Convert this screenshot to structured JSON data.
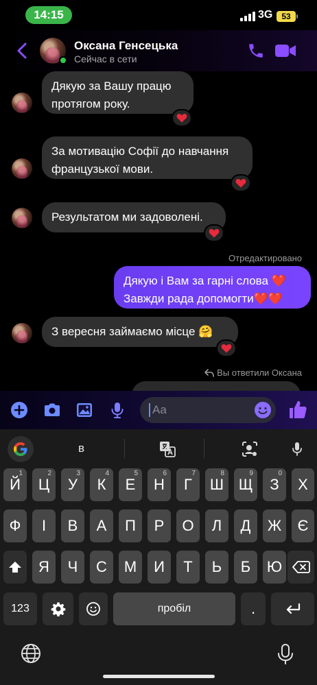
{
  "status_bar": {
    "time": "14:15",
    "network": "3G",
    "battery": "53"
  },
  "header": {
    "contact_name": "Оксана Генсецька",
    "contact_status": "Сейчас в сети"
  },
  "messages": [
    {
      "direction": "in",
      "lines": [
        "Дякую за Вашу працю",
        "протягом року."
      ],
      "reaction": "heart"
    },
    {
      "direction": "in",
      "lines": [
        "За мотивацію Софії до навчання",
        "французької мови."
      ],
      "reaction": "heart"
    },
    {
      "direction": "in",
      "lines": [
        "Результатом ми задоволені."
      ],
      "reaction": "heart"
    },
    {
      "direction": "out",
      "edited_label": "Отредактировано",
      "lines": [
        "Дякую і Вам за гарні слова ❤️",
        "Завжди рада допомогти❤️❤️"
      ]
    },
    {
      "direction": "in",
      "lines": [
        "З вересня займаємо місце 🤗"
      ],
      "reaction": "heart"
    }
  ],
  "reply_label": "Вы ответили Оксана",
  "composer": {
    "placeholder": "Aa"
  },
  "keyboard": {
    "suggestion": "в",
    "row1": [
      {
        "k": "Й",
        "hint": "1"
      },
      {
        "k": "Ц",
        "hint": "2"
      },
      {
        "k": "У",
        "hint": "3"
      },
      {
        "k": "К",
        "hint": "4"
      },
      {
        "k": "Е",
        "hint": "5"
      },
      {
        "k": "Н",
        "hint": "6"
      },
      {
        "k": "Г",
        "hint": "7"
      },
      {
        "k": "Ш",
        "hint": "8"
      },
      {
        "k": "Щ",
        "hint": "9"
      },
      {
        "k": "З",
        "hint": "0"
      },
      {
        "k": "Х",
        "hint": ""
      }
    ],
    "row2": [
      "Ф",
      "І",
      "В",
      "А",
      "П",
      "Р",
      "О",
      "Л",
      "Д",
      "Ж",
      "Є"
    ],
    "row3": [
      "Я",
      "Ч",
      "С",
      "М",
      "И",
      "Т",
      "Ь",
      "Б",
      "Ю"
    ],
    "numbers_key": "123",
    "space_key": "пробіл",
    "period_key": "."
  },
  "colors": {
    "accent": "#7b45ff",
    "outgoing_bubble": "#6f40f5",
    "incoming_bubble": "#303030",
    "heart": "#e52b3d",
    "online": "#31c94a",
    "time_pill": "#3bb54a"
  }
}
